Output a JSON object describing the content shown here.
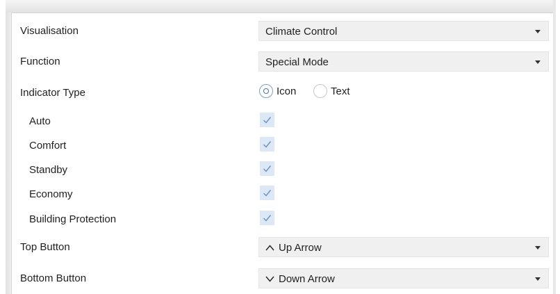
{
  "rows": {
    "visualisation": {
      "label": "Visualisation",
      "value": "Climate Control"
    },
    "function": {
      "label": "Function",
      "value": "Special Mode"
    },
    "indicator_type": {
      "label": "Indicator Type",
      "options": [
        {
          "label": "Icon",
          "selected": true
        },
        {
          "label": "Text",
          "selected": false
        }
      ]
    },
    "modes": [
      {
        "label": "Auto",
        "checked": true
      },
      {
        "label": "Comfort",
        "checked": true
      },
      {
        "label": "Standby",
        "checked": true
      },
      {
        "label": "Economy",
        "checked": true
      },
      {
        "label": "Building Protection",
        "checked": true
      }
    ],
    "top_button": {
      "label": "Top Button",
      "value": "Up Arrow",
      "icon": "chevron-up-icon"
    },
    "bottom_button": {
      "label": "Bottom Button",
      "value": "Down Arrow",
      "icon": "chevron-down-icon"
    }
  },
  "colors": {
    "checkbox_bg": "#dde8f6",
    "checkmark": "#6b8fc4",
    "radio_selected": "#4a6fa5",
    "dropdown_bg": "#f0f0f0"
  }
}
